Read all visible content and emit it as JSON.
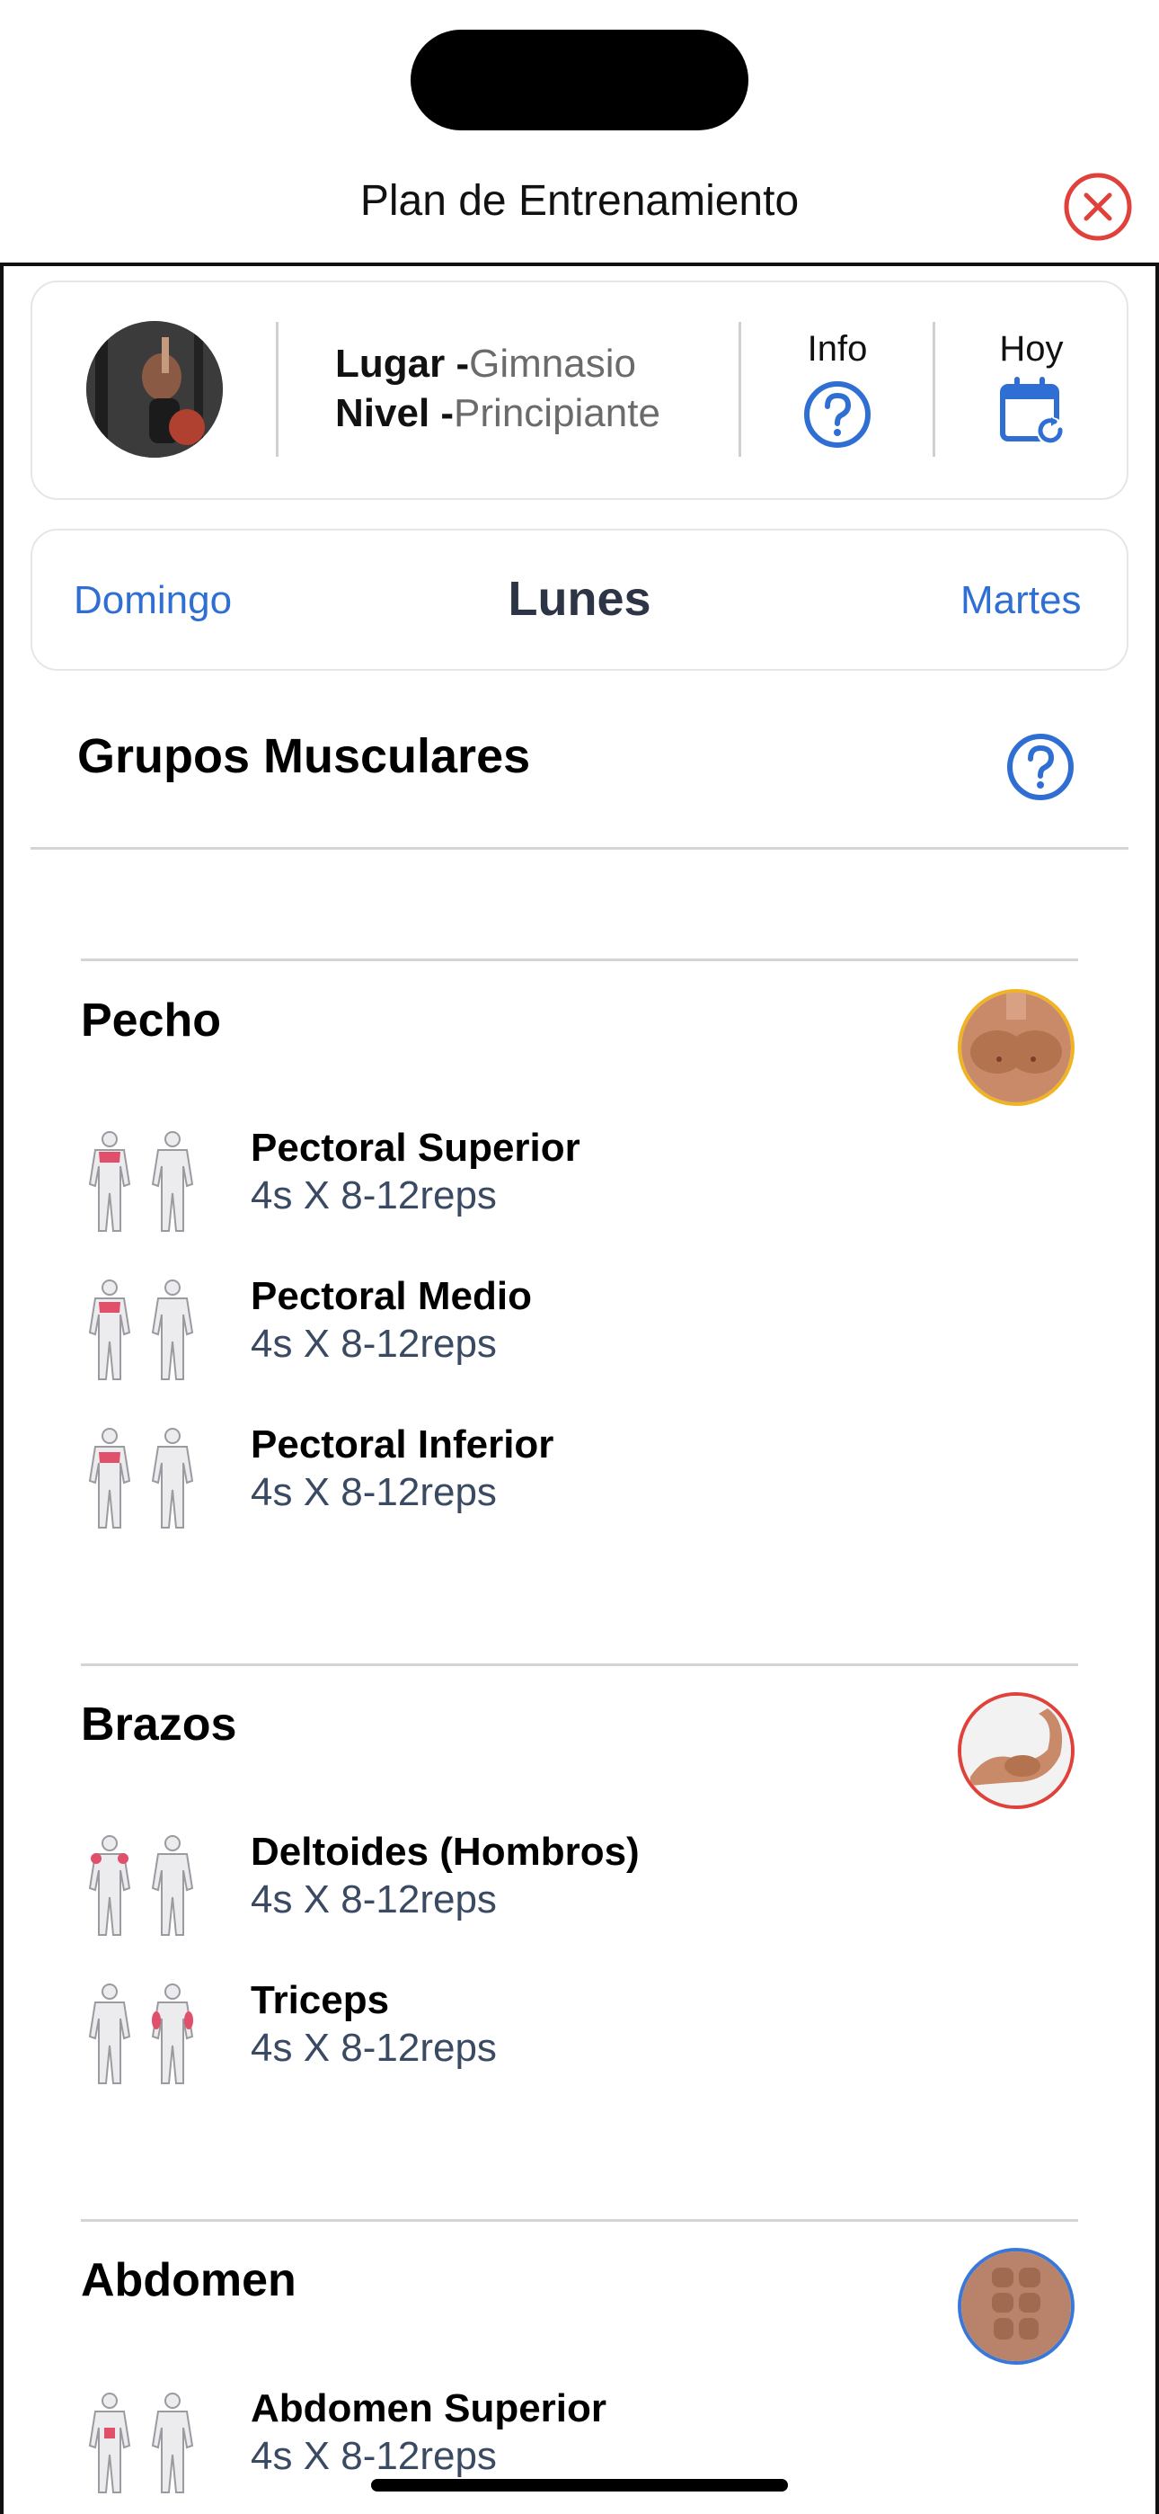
{
  "header": {
    "title": "Plan de Entrenamiento",
    "close_icon": "close-circle-icon",
    "close_color": "#e0413a"
  },
  "profile": {
    "lugar_key": "Lugar -",
    "lugar_value": "Gimnasio",
    "nivel_key": "Nivel -",
    "nivel_value": "Principiante",
    "info_label": "Info",
    "hoy_label": "Hoy"
  },
  "days": {
    "prev": "Domingo",
    "current": "Lunes",
    "next": "Martes"
  },
  "section": {
    "title": "Grupos Musculares"
  },
  "groups": [
    {
      "title": "Pecho",
      "exercises": [
        {
          "name": "Pectoral Superior",
          "sets": "4s X 8-12reps"
        },
        {
          "name": "Pectoral Medio",
          "sets": "4s X 8-12reps"
        },
        {
          "name": "Pectoral Inferior",
          "sets": "4s X 8-12reps"
        }
      ]
    },
    {
      "title": "Brazos",
      "exercises": [
        {
          "name": "Deltoides (Hombros)",
          "sets": "4s X 8-12reps"
        },
        {
          "name": "Triceps",
          "sets": "4s X 8-12reps"
        }
      ]
    },
    {
      "title": "Abdomen",
      "exercises": [
        {
          "name": "Abdomen Superior",
          "sets": "4s X 8-12reps"
        }
      ]
    }
  ],
  "colors": {
    "accent": "#2f6ed3",
    "highlight_muscle": "#e0506b",
    "pecho_ring": "#f0b323",
    "brazos_ring": "#e0413a",
    "abdomen_ring": "#3a78d8"
  }
}
